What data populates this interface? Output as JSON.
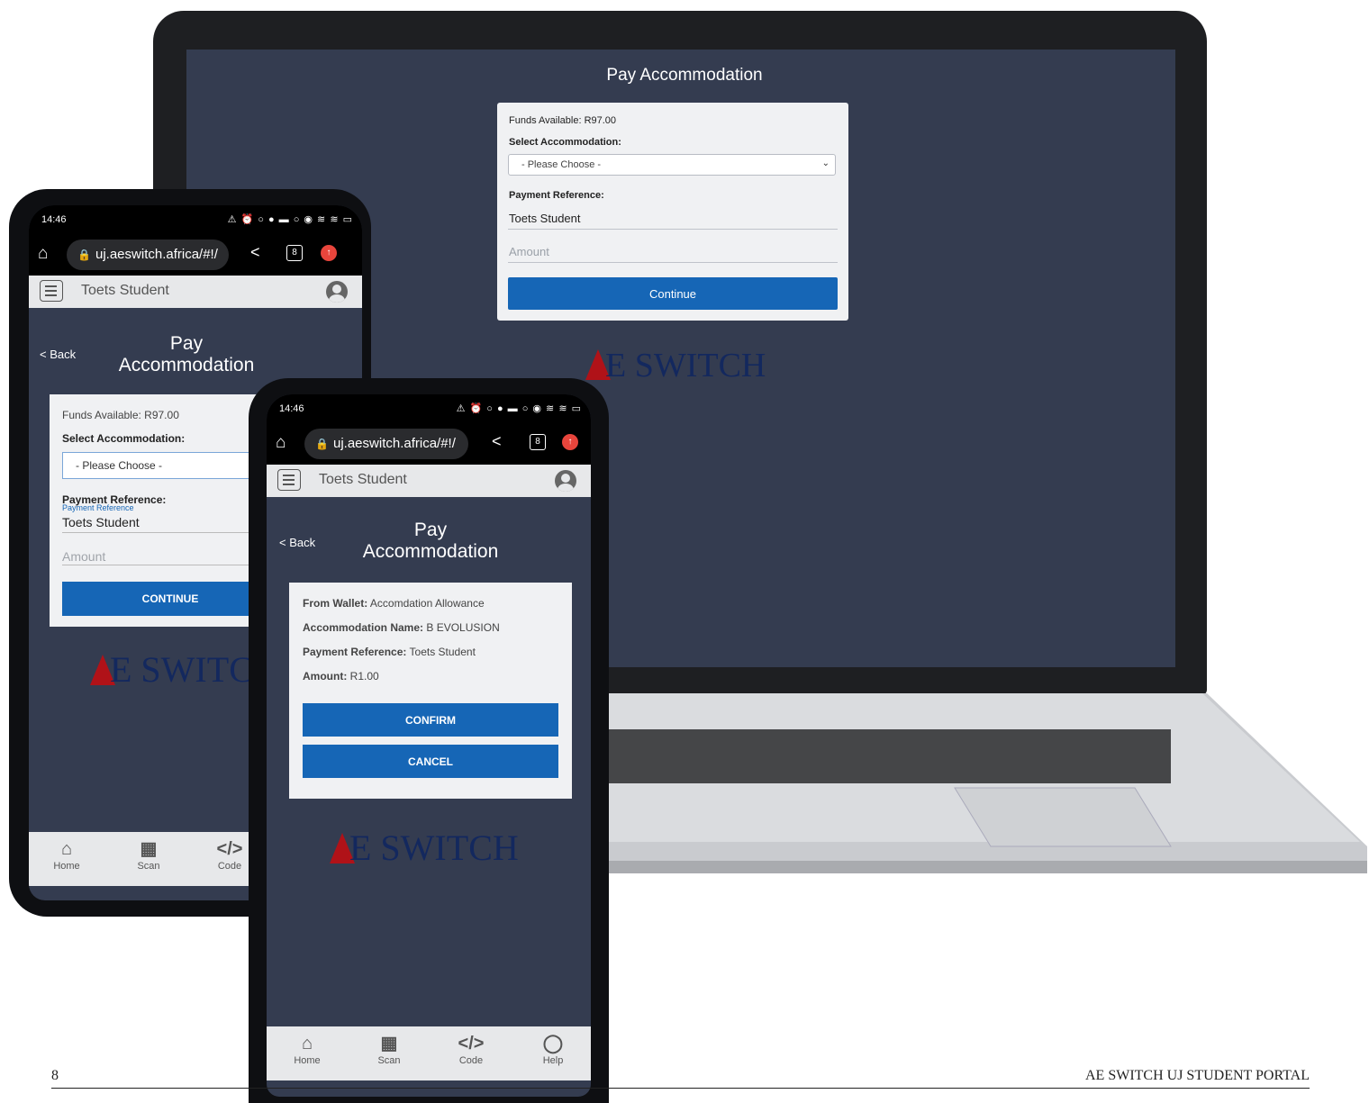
{
  "laptop": {
    "title": "Pay Accommodation",
    "funds": "Funds Available: R97.00",
    "select_label": "Select Accommodation:",
    "select_value": "- Please Choose -",
    "ref_label": "Payment Reference:",
    "ref_value": "Toets Student",
    "amount_placeholder": "Amount",
    "continue": "Continue",
    "logo_rest": "E SWITCH"
  },
  "phone_back": {
    "status_time": "14:46",
    "status_icons": "⚠ ⏰ ○ ● ▬ ○ ◉ ≋ ≋ ▭",
    "url": "uj.aeswitch.africa/#!/",
    "tab_count": "8",
    "user_name": "Toets Student",
    "back": "< Back",
    "title": "Pay Accommodation",
    "funds": "Funds Available: R97.00",
    "select_label": "Select Accommodation:",
    "select_value": "- Please Choose -",
    "ref_label": "Payment Reference:",
    "ref_hint": "Payment Reference",
    "ref_value": "Toets Student",
    "amount_placeholder": "Amount",
    "continue": "CONTINUE",
    "logo_rest": "E SWITC",
    "nav": [
      "Home",
      "Scan",
      "Code"
    ]
  },
  "phone_front": {
    "status_time": "14:46",
    "status_icons": "⚠ ⏰ ○ ● ▬ ○ ◉ ≋ ≋ ▭",
    "url": "uj.aeswitch.africa/#!/",
    "tab_count": "8",
    "user_name": "Toets Student",
    "back": "< Back",
    "title": "Pay Accommodation",
    "from_wallet_label": "From Wallet:",
    "from_wallet_value": "Accomdation Allowance",
    "acc_name_label": "Accommodation Name:",
    "acc_name_value": "B EVOLUSION",
    "ref_label": "Payment Reference:",
    "ref_value": "Toets Student",
    "amount_label": "Amount:",
    "amount_value": "R1.00",
    "confirm": "CONFIRM",
    "cancel": "CANCEL",
    "logo_rest": "E SWITCH",
    "nav": [
      "Home",
      "Scan",
      "Code",
      "Help"
    ]
  },
  "footer": {
    "page_number": "8",
    "title": "AE SWITCH UJ STUDENT PORTAL"
  }
}
